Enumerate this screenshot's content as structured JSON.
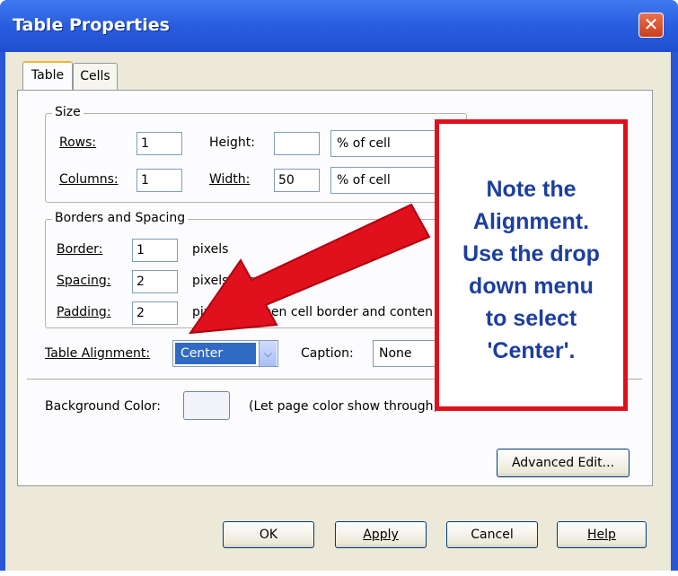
{
  "window": {
    "title": "Table Properties",
    "close_glyph": "✕"
  },
  "tabs": [
    {
      "label": "Table"
    },
    {
      "label": "Cells"
    }
  ],
  "size": {
    "legend": "Size",
    "rows_label": "Rows:",
    "rows_value": "1",
    "columns_label": "Columns:",
    "columns_value": "1",
    "height_label": "Height:",
    "height_value": "",
    "height_unit": "% of cell",
    "width_label": "Width:",
    "width_value": "50",
    "width_unit": "% of cell"
  },
  "borders": {
    "legend": "Borders and Spacing",
    "border_label": "Border:",
    "border_value": "1",
    "border_unit": "pixels",
    "spacing_label": "Spacing:",
    "spacing_value": "2",
    "spacing_desc": "pixels between cells",
    "padding_label": "Padding:",
    "padding_value": "2",
    "padding_desc": "pixels between cell border and contents"
  },
  "alignment": {
    "label": "Table Alignment:",
    "value": "Center"
  },
  "caption": {
    "label": "Caption:",
    "value": "None"
  },
  "background": {
    "label": "Background Color:",
    "hint": "(Let page color show through)"
  },
  "buttons": {
    "advanced": "Advanced Edit...",
    "ok": "OK",
    "apply": "Apply",
    "cancel": "Cancel",
    "help": "Help"
  },
  "annotation": {
    "lines": [
      "Note the",
      "Alignment.",
      "Use the drop",
      "down menu",
      "to select",
      "'Center'."
    ],
    "box_color": "#e0101c",
    "text_color": "#1c3f9e",
    "arrow_color": "#e0101c"
  },
  "icons": {
    "dropdown": "chevron-down-icon",
    "close": "close-icon"
  }
}
